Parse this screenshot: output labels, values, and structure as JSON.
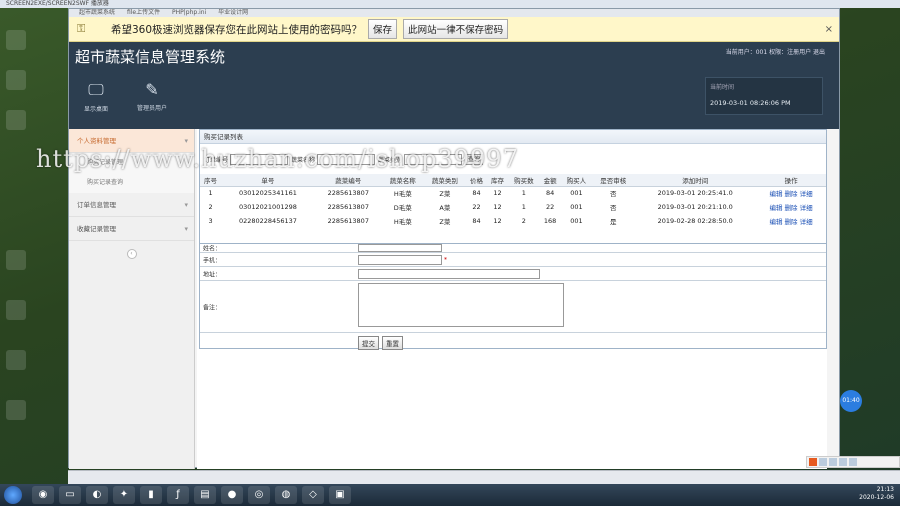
{
  "os": {
    "titlebar": "SCREEN2EXE/SCREEN2SWF 播放器",
    "clock_time": "21:13",
    "clock_date": "2020-12-06"
  },
  "browser": {
    "tabs": [
      "超市蔬菜系统",
      "file上传文件",
      "PHP|php.ini",
      "毕业设计网"
    ],
    "password_prompt": {
      "message": "希望360极速浏览器保存您在此网站上使用的密码吗？",
      "save_label": "保存",
      "never_label": "此网站一律不保存密码",
      "close_label": "×"
    }
  },
  "header": {
    "app_title": "超市蔬菜信息管理系统",
    "user_info": "当前用户：001 权限：注册用户 退出",
    "nav": [
      {
        "label": "显示桌面",
        "icon": "monitor-icon"
      },
      {
        "label": "管理员用户",
        "icon": "pen-icon"
      }
    ],
    "time_label": "当前时间",
    "time_value": "2019-03-01 08:26:06 PM"
  },
  "sidebar": {
    "groups": [
      {
        "label": "个人资料管理",
        "active": true
      },
      {
        "label": "订单信息管理",
        "active": false
      },
      {
        "label": "收藏记录管理",
        "active": false
      }
    ],
    "sub_items": [
      "购买记录管理",
      "购买记录查询"
    ],
    "collapse_label": "‹"
  },
  "panel": {
    "title": "购买记录列表",
    "search": {
      "field1_label": "订单编号",
      "field2_label": "蔬菜名称",
      "field3_label": "蔬菜类别",
      "button_label": "查询"
    },
    "columns": [
      "序号",
      "单号",
      "蔬菜编号",
      "蔬菜名称",
      "蔬菜类别",
      "价格",
      "库存",
      "购买数",
      "金额",
      "购买人",
      "是否审核",
      "添加时间",
      "操作"
    ],
    "rows": [
      {
        "no": "1",
        "order": "03012025341161",
        "code": "2285613807",
        "name": "H毛菜",
        "category": "Z菜",
        "price": "84",
        "stock": "12",
        "qty": "1",
        "amount": "84",
        "buyer": "001",
        "audited": "否",
        "time": "2019-03-01 20:25:41.0",
        "ops": "编辑 删除 详细"
      },
      {
        "no": "2",
        "order": "03012021001298",
        "code": "2285613807",
        "name": "D毛菜",
        "category": "A菜",
        "price": "22",
        "stock": "12",
        "qty": "1",
        "amount": "22",
        "buyer": "001",
        "audited": "否",
        "time": "2019-03-01 20:21:10.0",
        "ops": "编辑 删除 详细"
      },
      {
        "no": "3",
        "order": "02280228456137",
        "code": "2285613807",
        "name": "H毛菜",
        "category": "Z菜",
        "price": "84",
        "stock": "12",
        "qty": "2",
        "amount": "168",
        "buyer": "001",
        "audited": "是",
        "time": "2019-02-28 02:28:50.0",
        "ops": "编辑 删除 详细"
      }
    ]
  },
  "form": {
    "name_label": "姓名：",
    "phone_label": "手机：",
    "required_mark": "*",
    "address_label": "地址：",
    "note_label": "备注：",
    "submit_label": "提交",
    "reset_label": "重置"
  },
  "overlays": {
    "watermark": "https://www.huzhan.com/ishop39997",
    "bubble": "01:40"
  }
}
